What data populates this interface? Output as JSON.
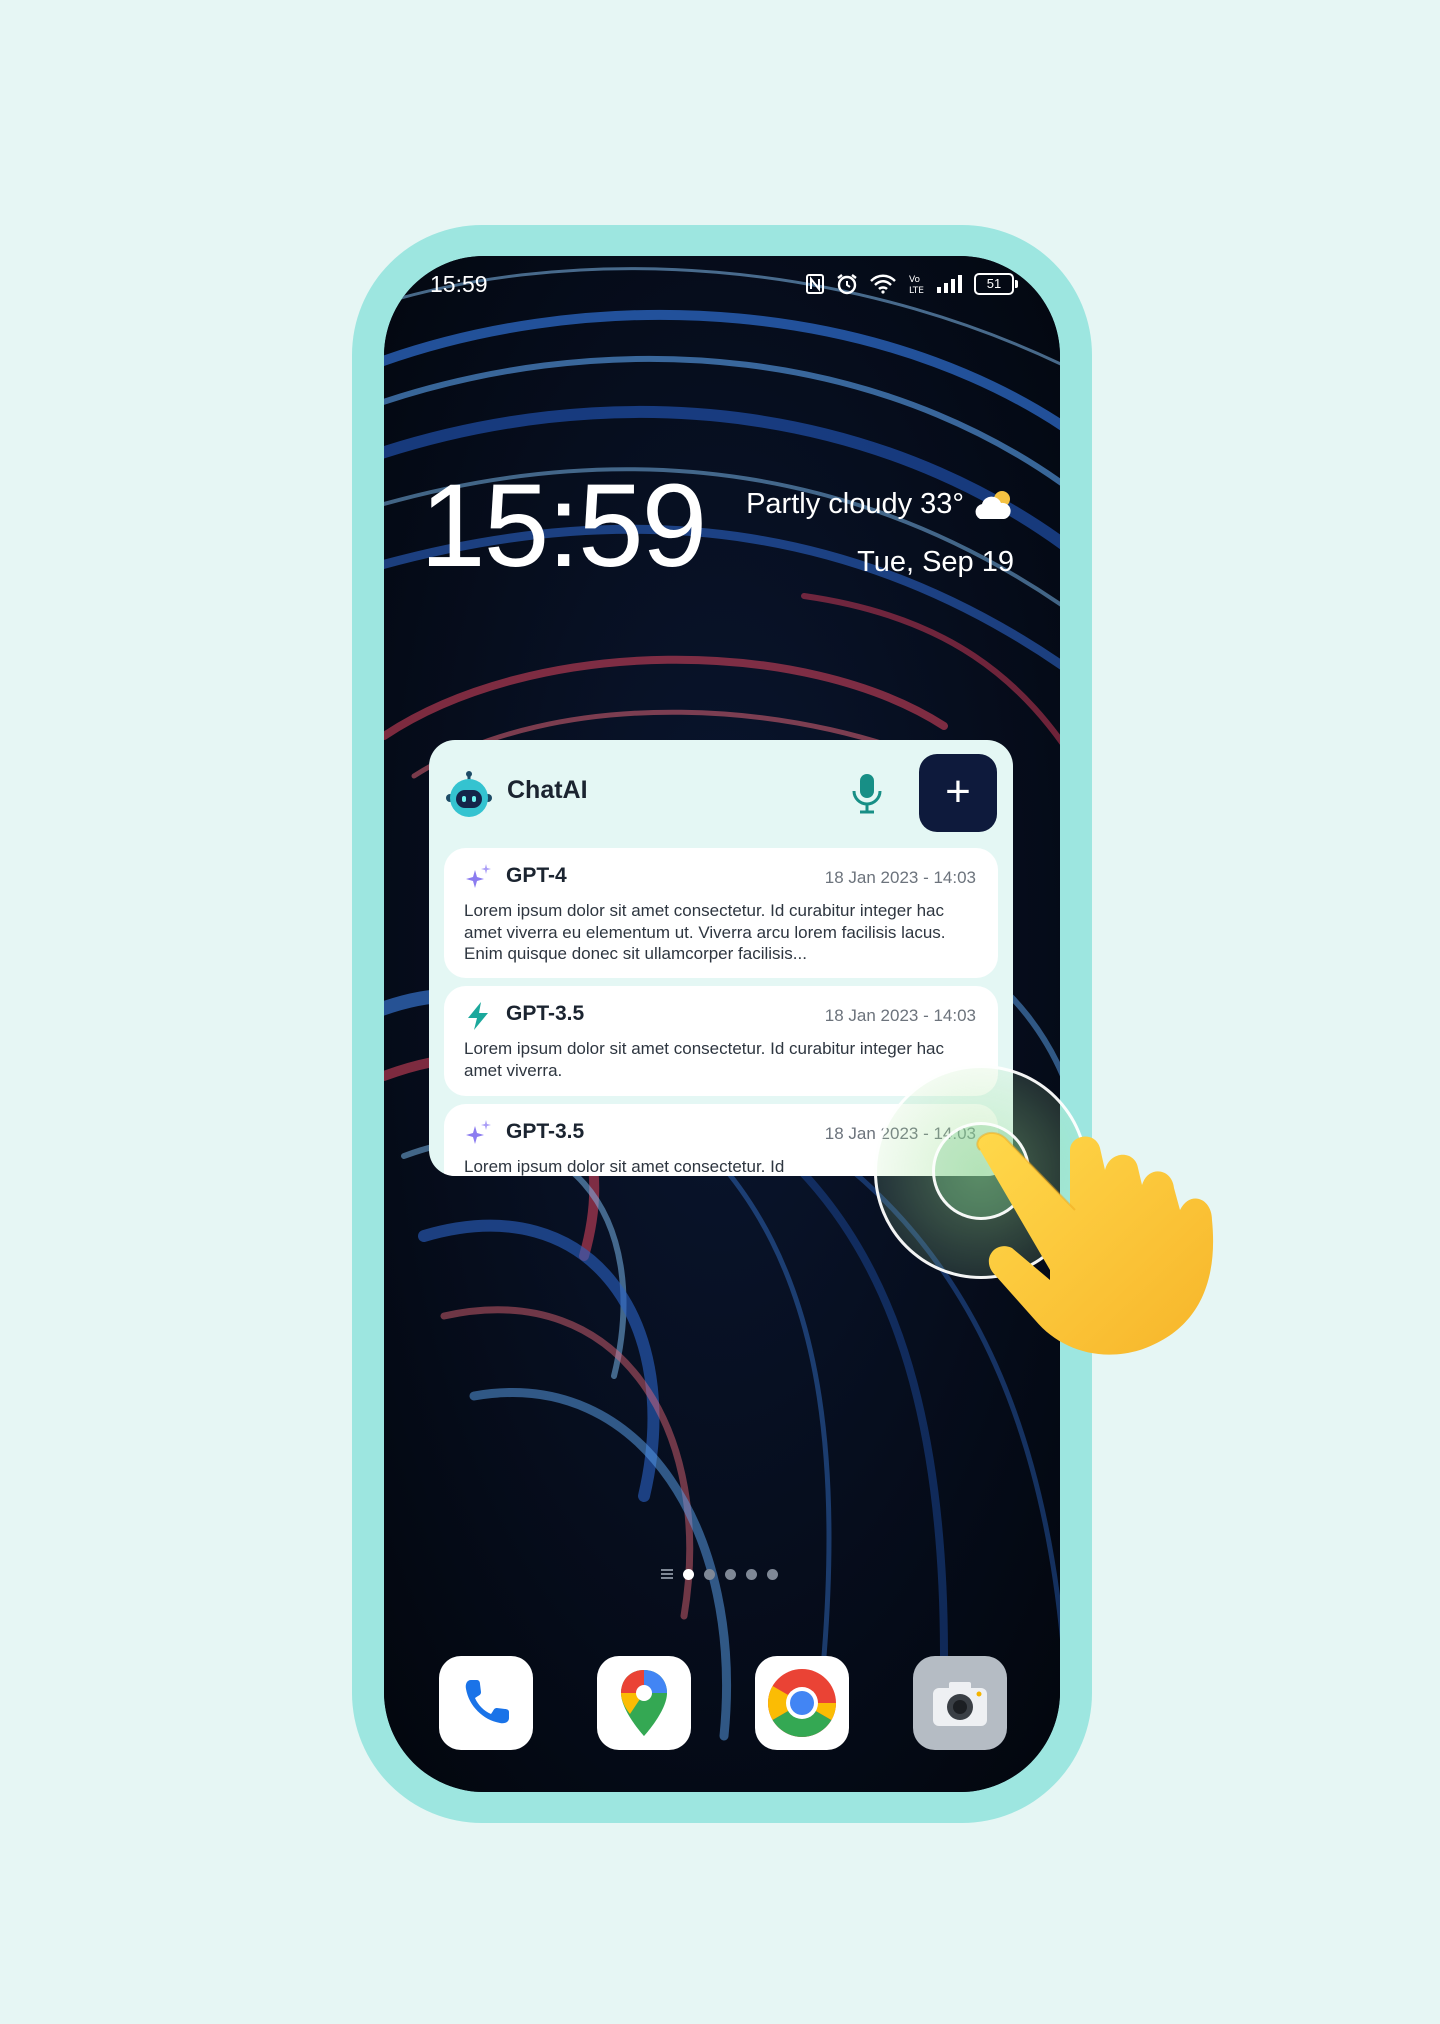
{
  "status_bar": {
    "time": "15:59",
    "battery": "51",
    "icons": [
      "nfc-icon",
      "alarm-icon",
      "wifi-icon",
      "volte-icon",
      "signal-icon",
      "battery-icon"
    ]
  },
  "lock_widget": {
    "clock": "15:59",
    "weather": "Partly cloudy 33°",
    "weather_icon": "partly-cloudy-icon",
    "date": "Tue, Sep 19"
  },
  "chat_widget": {
    "app_name": "ChatAI",
    "add_label": "+",
    "accent": "#0e1a3c",
    "cards": [
      {
        "model": "GPT-4",
        "icon": "sparkle-icon",
        "timestamp": "18 Jan 2023 - 14:03",
        "text": "Lorem ipsum dolor sit amet consectetur. Id curabitur integer hac amet viverra eu elementum ut. Viverra arcu lorem facilisis lacus. Enim quisque donec sit ullamcorper facilisis..."
      },
      {
        "model": "GPT-3.5",
        "icon": "bolt-icon",
        "timestamp": "18 Jan 2023 - 14:03",
        "text": "Lorem ipsum dolor sit amet consectetur. Id curabitur integer hac amet viverra."
      },
      {
        "model": "GPT-3.5",
        "icon": "sparkle-icon",
        "timestamp": "18 Jan 2023 - 14:03",
        "text": "Lorem ipsum dolor sit amet consectetur. Id"
      }
    ]
  },
  "home": {
    "pages": 5,
    "active_page": 1,
    "dock": [
      "phone-icon",
      "maps-icon",
      "chrome-icon",
      "camera-icon"
    ]
  }
}
